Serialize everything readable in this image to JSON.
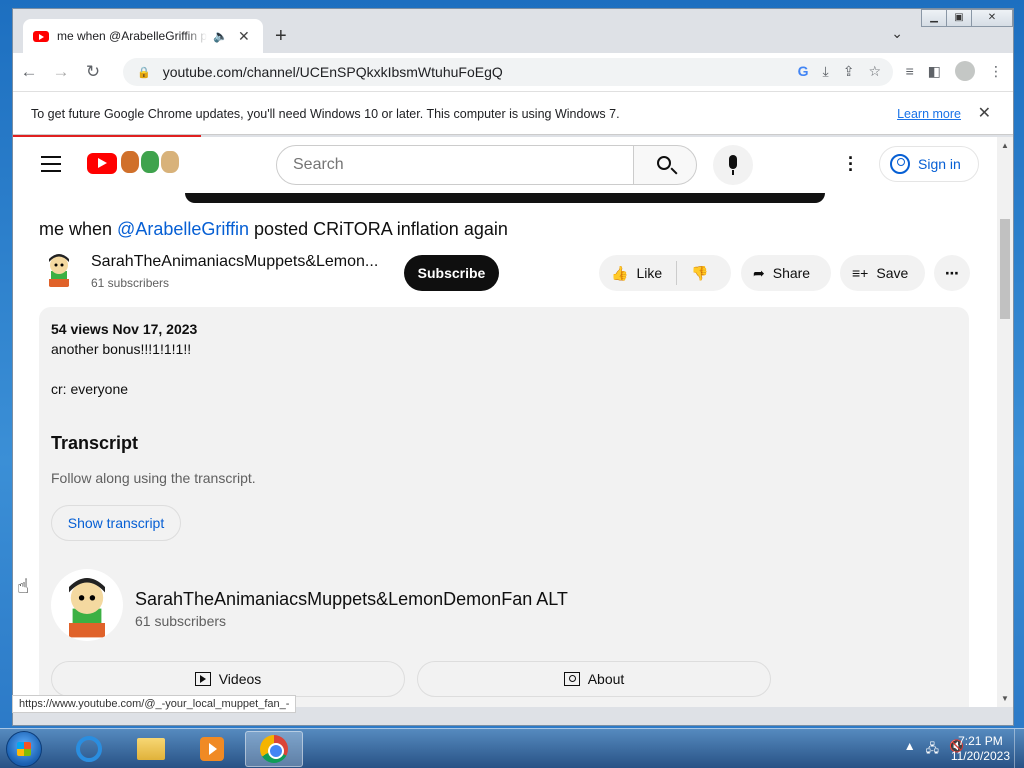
{
  "browser": {
    "tab_title": "me when @ArabelleGriffin p",
    "new_tab_symbol": "+",
    "url": "youtube.com/channel/UCEnSPQkxkIbsmWtuhuFoEgQ",
    "infobar": {
      "message": "To get future Google Chrome updates, you'll need Windows 10 or later. This computer is using Windows 7.",
      "learn_more": "Learn more"
    },
    "status_url": "https://www.youtube.com/@_-your_local_muppet_fan_-"
  },
  "youtube": {
    "search_placeholder": "Search",
    "sign_in": "Sign in",
    "video": {
      "title_prefix": "me when ",
      "title_mention": "@ArabelleGriffin",
      "title_suffix": " posted CRiTORA inflation again",
      "channel_name": "SarahTheAnimaniacsMuppets&LemonDemonFan ALT",
      "channel_name_truncated": "SarahTheAnimaniacsMuppets&Lemon...",
      "subscribers": "61 subscribers",
      "subscribe": "Subscribe",
      "like": "Like",
      "share": "Share",
      "save": "Save"
    },
    "description": {
      "meta": "54 views  Nov 17, 2023",
      "line1": "another bonus!!!1!1!1!!",
      "line2": "cr: everyone",
      "transcript_heading": "Transcript",
      "transcript_sub": "Follow along using the transcript.",
      "show_transcript": "Show transcript",
      "channel_name": "SarahTheAnimaniacsMuppets&LemonDemonFan ALT",
      "channel_subs": "61 subscribers",
      "videos": "Videos",
      "about": "About"
    }
  },
  "taskbar": {
    "time": "7:21 PM",
    "date": "11/20/2023"
  },
  "colors": {
    "yt_red": "#ff0000",
    "link_blue": "#065fd4",
    "chrome_blue": "#1a73e8"
  }
}
